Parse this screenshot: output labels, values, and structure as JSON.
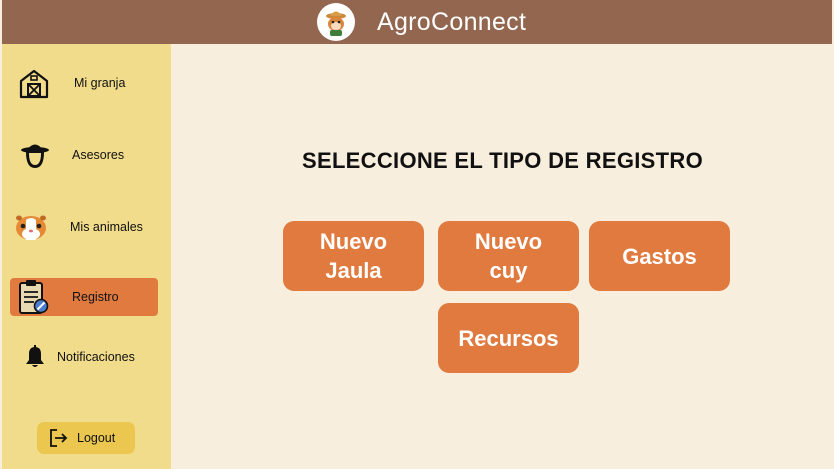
{
  "header": {
    "title": "AgroConnect",
    "logo_icon": "farmer-guinea-pig-logo"
  },
  "sidebar": {
    "items": [
      {
        "label": "Mi granja",
        "icon": "barn-icon"
      },
      {
        "label": "Asesores",
        "icon": "advisor-icon"
      },
      {
        "label": "Mis animales",
        "icon": "guinea-pig-icon"
      },
      {
        "label": "Registro",
        "icon": "clipboard-icon",
        "active": true
      },
      {
        "label": "Notificaciones",
        "icon": "bell-icon"
      }
    ],
    "logout_label": "Logout"
  },
  "main": {
    "title": "SELECCIONE EL TIPO DE REGISTRO",
    "options": [
      "Nuevo Jaula",
      "Nuevo cuy",
      "Gastos",
      "Recursos"
    ]
  },
  "colors": {
    "header": "#93664f",
    "sidebar": "#f1dc8c",
    "accent": "#e07a3f",
    "background": "#f7eedd",
    "logout": "#ebc74f"
  }
}
